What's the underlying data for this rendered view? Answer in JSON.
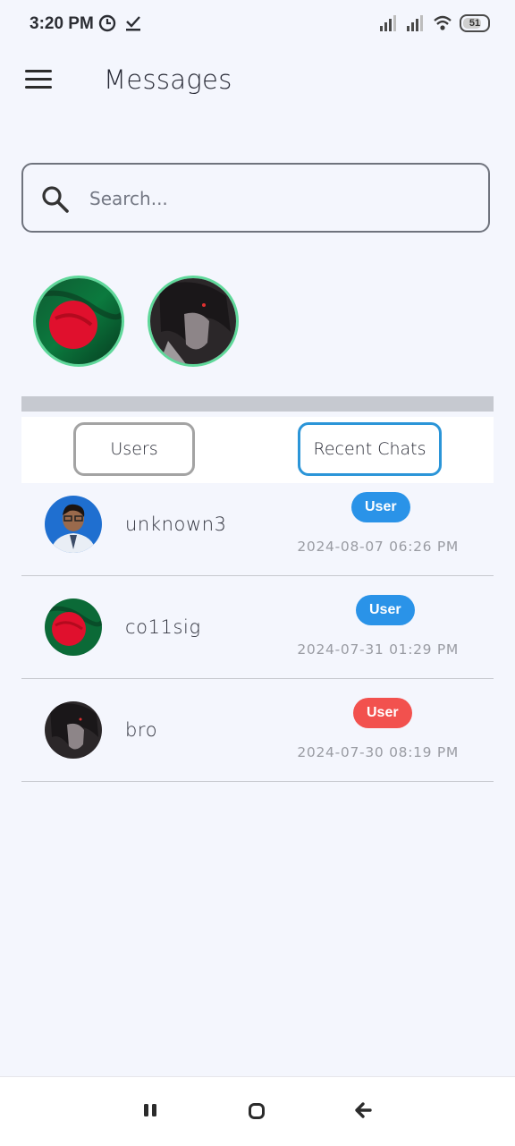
{
  "status_bar": {
    "time": "3:20 PM",
    "icons_left": [
      "clock-icon",
      "download-done-icon"
    ],
    "icons_right": [
      "signal-icon",
      "signal-icon",
      "wifi-icon",
      "battery-icon"
    ],
    "battery_level": "51"
  },
  "app_bar": {
    "menu_icon": "hamburger-menu-icon",
    "title": "Messages"
  },
  "search": {
    "placeholder": "Search...",
    "value": "",
    "icon": "search-icon"
  },
  "stories": [
    {
      "avatar": "bangladesh-flag"
    },
    {
      "avatar": "dark-anime-character"
    }
  ],
  "tabs": {
    "users_label": "Users",
    "recent_label": "Recent Chats",
    "active": "Recent Chats"
  },
  "chats": [
    {
      "name": "unknown3",
      "badge": "User",
      "badge_color": "#2a93e8",
      "time": "2024-08-07 06:26 PM",
      "avatar": "person-photo"
    },
    {
      "name": "co11sig",
      "badge": "User",
      "badge_color": "#2a93e8",
      "time": "2024-07-31 01:29 PM",
      "avatar": "bangladesh-flag"
    },
    {
      "name": "bro",
      "badge": "User",
      "badge_color": "#f2514e",
      "time": "2024-07-30 08:19 PM",
      "avatar": "dark-anime-character"
    }
  ],
  "nav_bar": {
    "buttons": [
      "recents-icon",
      "home-icon",
      "back-icon"
    ]
  },
  "colors": {
    "background": "#f4f6fd",
    "accent_blue": "#2b95d8",
    "story_ring": "#5fd89a",
    "badge_red": "#f2514e"
  }
}
